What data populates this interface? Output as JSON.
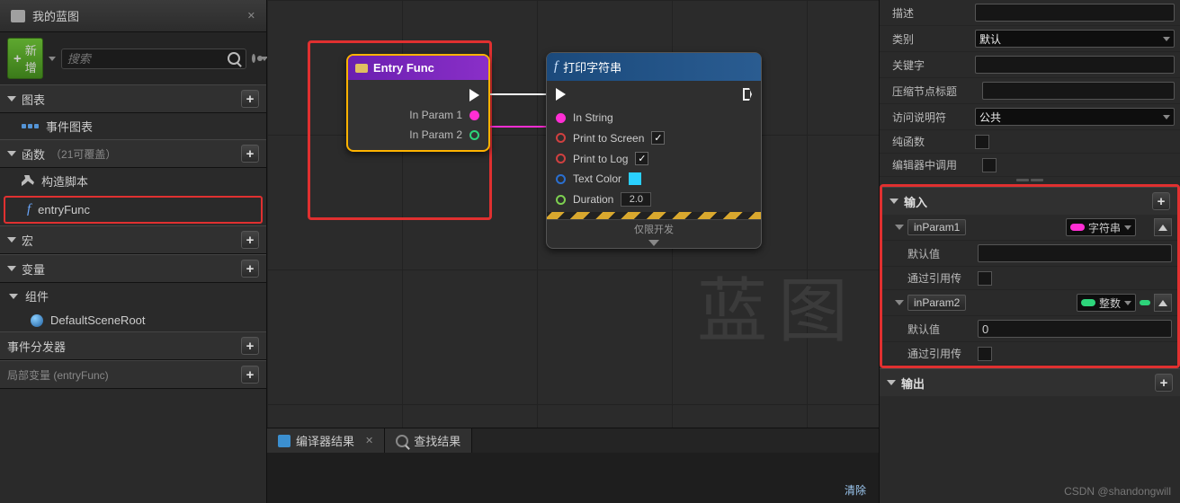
{
  "left": {
    "title": "我的蓝图",
    "add_label": "新增",
    "search_placeholder": "搜索",
    "sections": {
      "charts": "图表",
      "event_graph": "事件图表",
      "functions": "函数",
      "functions_note": "（21可覆盖）",
      "construct": "构造脚本",
      "entry_func": "entryFunc",
      "macros": "宏",
      "variables": "变量",
      "components": "组件",
      "default_scene_root": "DefaultSceneRoot",
      "dispatchers": "事件分发器",
      "local_vars": "局部变量 (entryFunc)"
    }
  },
  "graph": {
    "watermark": "蓝图",
    "entry_node": {
      "title": "Entry Func",
      "p1": "In Param 1",
      "p2": "In Param 2"
    },
    "print_node": {
      "title": "打印字符串",
      "in_string": "In String",
      "print_screen": "Print to Screen",
      "print_log": "Print to Log",
      "text_color": "Text Color",
      "duration": "Duration",
      "duration_val": "2.0",
      "dev_only": "仅限开发"
    }
  },
  "bottom": {
    "compiler": "编译器结果",
    "search": "查找结果",
    "clear": "清除"
  },
  "right": {
    "desc": "描述",
    "category": "类别",
    "category_val": "默认",
    "keywords": "关键字",
    "compact": "压缩节点标题",
    "access": "访问说明符",
    "access_val": "公共",
    "pure": "纯函数",
    "editor_call": "编辑器中调用",
    "inputs": "输入",
    "outputs": "输出",
    "in1": {
      "name": "inParam1",
      "type": "字符串",
      "default_lbl": "默认值",
      "ref_lbl": "通过引用传"
    },
    "in2": {
      "name": "inParam2",
      "type": "整数",
      "default_lbl": "默认值",
      "default_val": "0",
      "ref_lbl": "通过引用传"
    }
  },
  "watermark_credit": "CSDN @shandongwill"
}
